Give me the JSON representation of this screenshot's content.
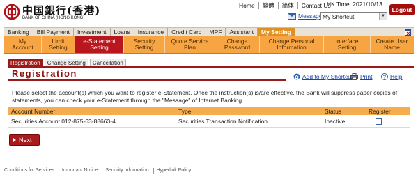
{
  "brand": {
    "name_cn": "中国銀行(香港)",
    "name_en": "BANK OF CHINA (HONG KONG)",
    "logo": "boc-emblem-logo"
  },
  "header": {
    "links": [
      {
        "label": "Home"
      },
      {
        "label": "繁體"
      },
      {
        "label": "简体"
      },
      {
        "label": "Contact Us"
      }
    ],
    "hk_time": "HK Time: 2021/10/13",
    "logout_label": "Logout",
    "message_label": "Message",
    "message_icon": "envelope-icon",
    "shortcut_selected": "My Shortcut"
  },
  "main_nav": {
    "items": [
      {
        "label": "Banking",
        "active": false
      },
      {
        "label": "Bill Payment",
        "active": false
      },
      {
        "label": "Investment",
        "active": false
      },
      {
        "label": "Loans",
        "active": false
      },
      {
        "label": "Insurance",
        "active": false
      },
      {
        "label": "Credit Card",
        "active": false
      },
      {
        "label": "MPF",
        "active": false
      },
      {
        "label": "Assistant",
        "active": false
      },
      {
        "label": "My Setting",
        "active": true
      }
    ],
    "right_icon": "close-window-icon"
  },
  "sub_nav": {
    "items": [
      {
        "line1": "My",
        "line2": "Account",
        "active": false
      },
      {
        "line1": "Limit",
        "line2": "Setting",
        "active": false
      },
      {
        "line1": "e-Statement",
        "line2": "Setting",
        "active": true
      },
      {
        "line1": "Security",
        "line2": "Setting",
        "active": false
      },
      {
        "line1": "Quote Service",
        "line2": "Plan",
        "active": false
      },
      {
        "line1": "Change",
        "line2": "Password",
        "active": false
      },
      {
        "line1": "Change Personal",
        "line2": "Information",
        "active": false
      },
      {
        "line1": "Interface",
        "line2": "Setting",
        "active": false
      },
      {
        "line1": "Create User",
        "line2": "Name",
        "active": false
      }
    ]
  },
  "tabs": [
    {
      "label": "Registration",
      "active": true
    },
    {
      "label": "Change Setting",
      "active": false
    },
    {
      "label": "Cancellation",
      "active": false
    }
  ],
  "page_title": "Registration",
  "tools": {
    "shortcut_label": "Add to My Shortcut",
    "shortcut_icon": "house-plus-icon",
    "print_label": "Print",
    "print_icon": "printer-icon",
    "help_label": "Help",
    "help_icon": "question-circle-icon"
  },
  "description": "Please select the account(s) which you want to register e-Statement. Once the instruction(s) is/are effective, the Bank will suppress paper copies of statements, you can check your e-Statement through the \"Message\" of Internet Banking.",
  "table": {
    "headers": [
      "Account Number",
      "Type",
      "Status",
      "Register"
    ],
    "rows": [
      {
        "account": "Securities Account 012-875-63-88663-4",
        "type": "Securities Transaction Notification",
        "status": "Inactive",
        "register": false
      }
    ]
  },
  "next_label": "Next",
  "footer": {
    "links": [
      {
        "label": "Conditions for Services"
      },
      {
        "label": "Important Notice"
      },
      {
        "label": "Security Information"
      },
      {
        "label": "Hyperlink Policy"
      }
    ]
  },
  "colors": {
    "brand_red": "#9b1a19",
    "nav_orange": "#f7a542",
    "active_orange": "#e09123",
    "link_blue": "#1a47a3"
  }
}
